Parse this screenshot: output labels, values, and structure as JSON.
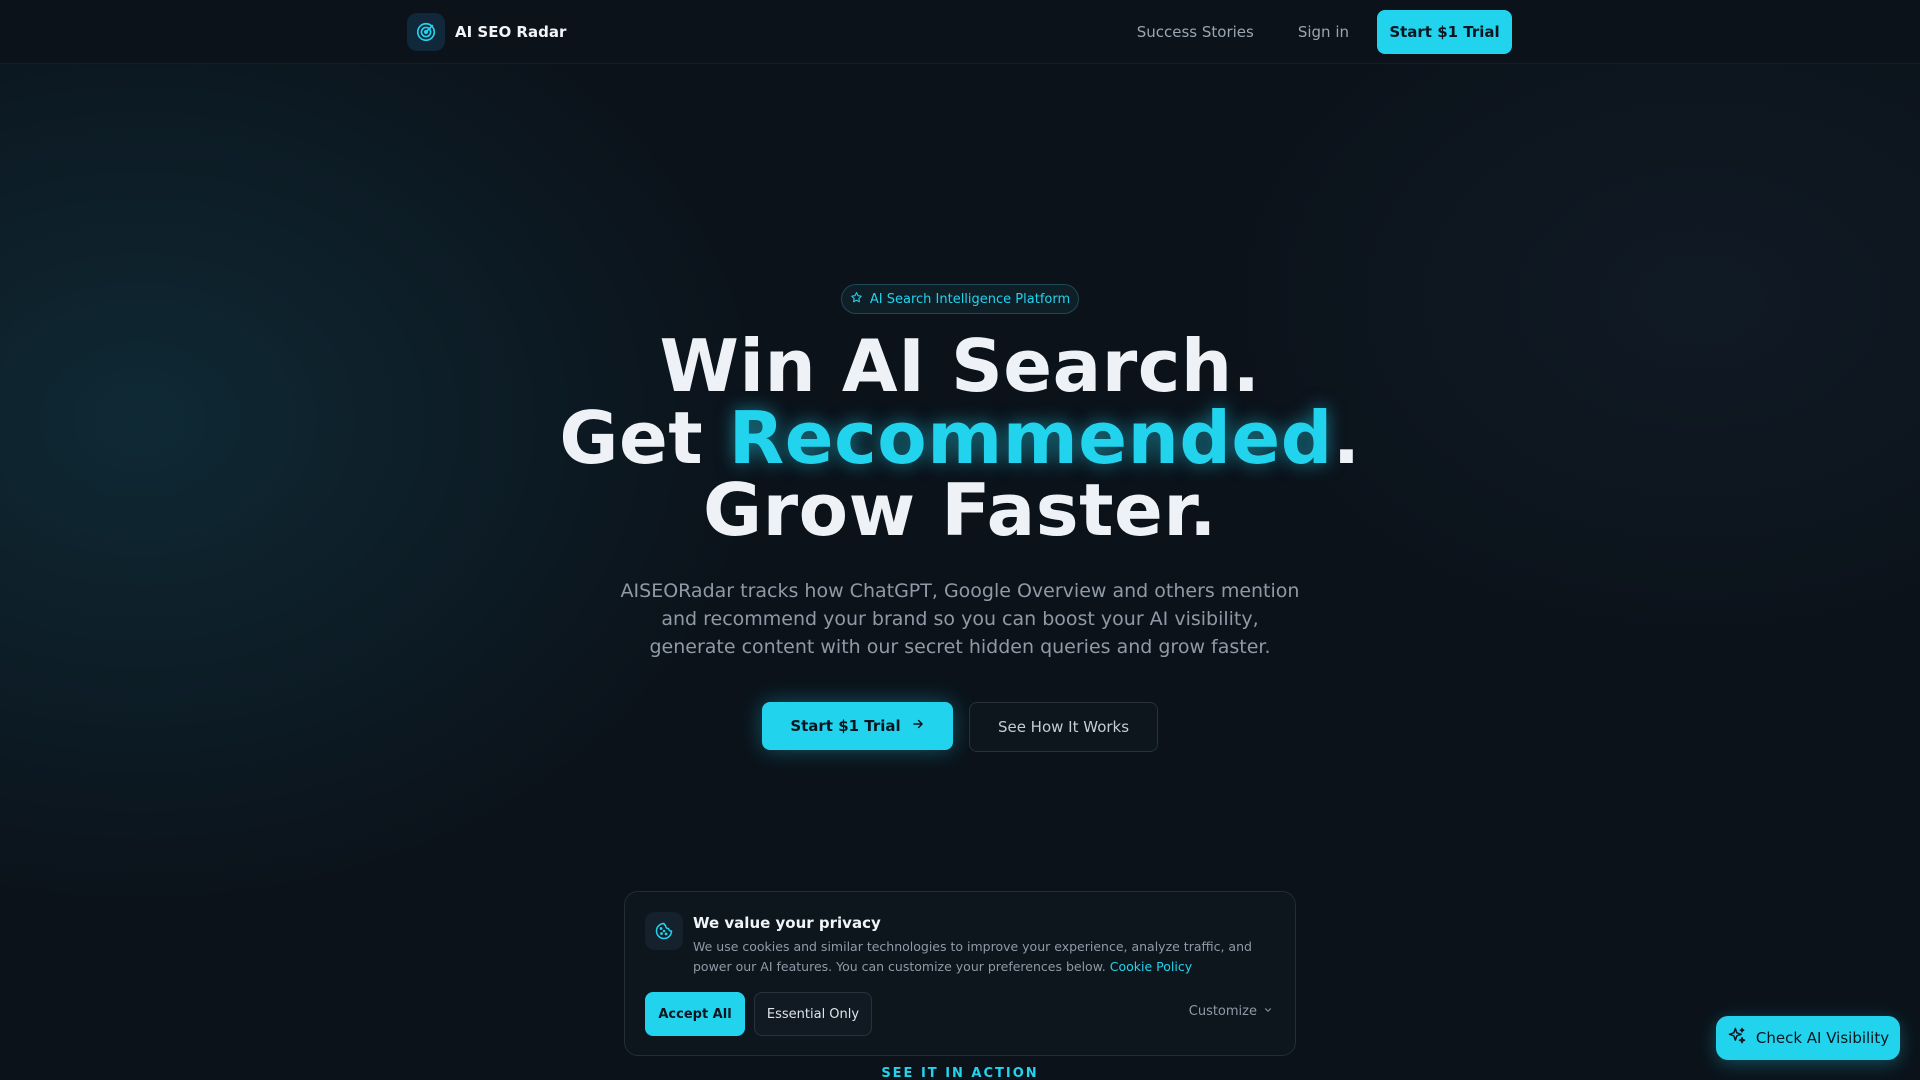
{
  "header": {
    "brand_name": "AI SEO Radar",
    "logo_icon": "radar-icon",
    "nav": {
      "success_stories": "Success Stories",
      "sign_in": "Sign in",
      "start_trial": "Start $1 Trial"
    }
  },
  "hero": {
    "badge": {
      "icon": "star-icon",
      "label": "AI Search Intelligence Platform"
    },
    "headline": {
      "line1": "Win AI Search.",
      "line2_before": "Get ",
      "line2_accent": "Recommended",
      "line2_after": ".",
      "line3": "Grow Faster."
    },
    "subheadline": "AISEORadar tracks how ChatGPT, Google Overview and others mention and recommend your brand so you can boost your AI visibility, generate content with our secret hidden queries and grow faster.",
    "cta_primary": "Start $1 Trial",
    "cta_secondary": "See How It Works"
  },
  "cookie_banner": {
    "icon": "cookie-icon",
    "title": "We value your privacy",
    "text": "We use cookies and similar technologies to improve your experience, analyze traffic, and power our AI features. You can customize your preferences below.",
    "policy_link": "Cookie Policy",
    "accept_all": "Accept All",
    "essential_only": "Essential Only",
    "customize": "Customize"
  },
  "section_label": "SEE IT IN ACTION",
  "floating_button": {
    "icon": "sparkles-icon",
    "label": "Check AI Visibility"
  },
  "colors": {
    "accent": "#22d3ee",
    "background": "#0b121a",
    "text_primary": "#eef2f6",
    "text_muted": "#8f9aa6"
  }
}
